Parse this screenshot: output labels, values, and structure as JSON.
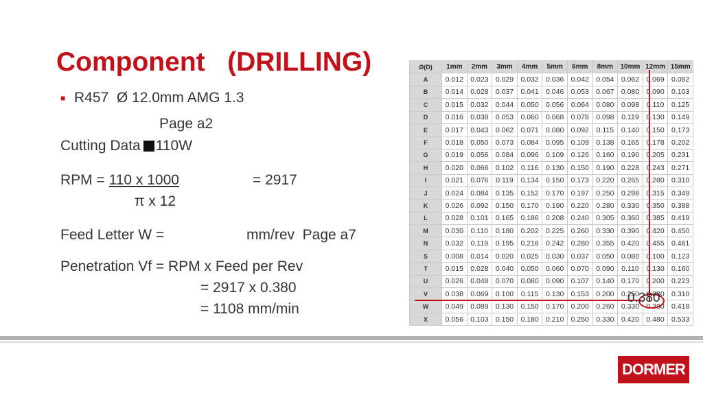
{
  "title": "Component   (DRILLING)",
  "bullet": "R457  Ø 12.0mm AMG 1.3",
  "page_a2": "Page a2",
  "cutting_data_label": "Cutting Data",
  "cutting_data_value": "110W",
  "rpm_prefix": "RPM = ",
  "rpm_numerator": "110 x 1000",
  "rpm_result": "= 2917",
  "rpm_denominator": "π x 12",
  "feed_letter": "Feed Letter W =",
  "feed_unit": "mm/rev  Page a7",
  "penetration": "Penetration Vf = RPM x Feed per Rev",
  "calc1": "= 2917 x 0.380",
  "calc2": "= 1108 mm/min",
  "annotation": "0.380",
  "logo": "DORMER",
  "table": {
    "corner": "Ø(D)",
    "columns": [
      "1mm",
      "2mm",
      "3mm",
      "4mm",
      "5mm",
      "6mm",
      "8mm",
      "10mm",
      "12mm",
      "15mm"
    ],
    "rows": [
      {
        "letter": "A",
        "values": [
          "0.012",
          "0.023",
          "0.029",
          "0.032",
          "0.036",
          "0.042",
          "0.054",
          "0.062",
          "0.069",
          "0.082"
        ]
      },
      {
        "letter": "B",
        "values": [
          "0.014",
          "0.028",
          "0.037",
          "0.041",
          "0.046",
          "0.053",
          "0.067",
          "0.080",
          "0.090",
          "0.103"
        ]
      },
      {
        "letter": "C",
        "values": [
          "0.015",
          "0.032",
          "0.044",
          "0.050",
          "0.056",
          "0.064",
          "0.080",
          "0.098",
          "0.110",
          "0.125"
        ]
      },
      {
        "letter": "D",
        "values": [
          "0.016",
          "0.038",
          "0.053",
          "0.060",
          "0.068",
          "0.078",
          "0.098",
          "0.119",
          "0.130",
          "0.149"
        ]
      },
      {
        "letter": "E",
        "values": [
          "0.017",
          "0.043",
          "0.062",
          "0.071",
          "0.080",
          "0.092",
          "0.115",
          "0.140",
          "0.150",
          "0.173"
        ]
      },
      {
        "letter": "F",
        "values": [
          "0.018",
          "0.050",
          "0.073",
          "0.084",
          "0.095",
          "0.109",
          "0.138",
          "0.165",
          "0.178",
          "0.202"
        ]
      },
      {
        "letter": "G",
        "values": [
          "0.019",
          "0.056",
          "0.084",
          "0.096",
          "0.109",
          "0.126",
          "0.160",
          "0.190",
          "0.205",
          "0.231"
        ]
      },
      {
        "letter": "H",
        "values": [
          "0.020",
          "0.066",
          "0.102",
          "0.116",
          "0.130",
          "0.150",
          "0.190",
          "0.228",
          "0.243",
          "0.271"
        ]
      },
      {
        "letter": "I",
        "values": [
          "0.021",
          "0.076",
          "0.119",
          "0.134",
          "0.150",
          "0.173",
          "0.220",
          "0.265",
          "0.280",
          "0.310"
        ]
      },
      {
        "letter": "J",
        "values": [
          "0.024",
          "0.084",
          "0.135",
          "0.152",
          "0.170",
          "0.197",
          "0.250",
          "0.298",
          "0.315",
          "0.349"
        ]
      },
      {
        "letter": "K",
        "values": [
          "0.026",
          "0.092",
          "0.150",
          "0.170",
          "0.190",
          "0.220",
          "0.280",
          "0.330",
          "0.350",
          "0.388"
        ]
      },
      {
        "letter": "L",
        "values": [
          "0.028",
          "0.101",
          "0.165",
          "0.186",
          "0.208",
          "0.240",
          "0.305",
          "0.360",
          "0.385",
          "0.419"
        ]
      },
      {
        "letter": "M",
        "values": [
          "0.030",
          "0.110",
          "0.180",
          "0.202",
          "0.225",
          "0.260",
          "0.330",
          "0.390",
          "0.420",
          "0.450"
        ]
      },
      {
        "letter": "N",
        "values": [
          "0.032",
          "0.119",
          "0.195",
          "0.218",
          "0.242",
          "0.280",
          "0.355",
          "0.420",
          "0.455",
          "0.481"
        ]
      },
      {
        "letter": "S",
        "values": [
          "0.008",
          "0.014",
          "0.020",
          "0.025",
          "0.030",
          "0.037",
          "0.050",
          "0.080",
          "0.100",
          "0.123"
        ]
      },
      {
        "letter": "T",
        "values": [
          "0.015",
          "0.028",
          "0.040",
          "0.050",
          "0.060",
          "0.070",
          "0.090",
          "0.110",
          "0.130",
          "0.160"
        ]
      },
      {
        "letter": "U",
        "values": [
          "0.026",
          "0.048",
          "0.070",
          "0.080",
          "0.090",
          "0.107",
          "0.140",
          "0.170",
          "0.200",
          "0.223"
        ]
      },
      {
        "letter": "V",
        "values": [
          "0.038",
          "0.069",
          "0.100",
          "0.115",
          "0.130",
          "0.153",
          "0.200",
          "0.250",
          "0.280",
          "0.310"
        ]
      },
      {
        "letter": "W",
        "values": [
          "0.049",
          "0.089",
          "0.130",
          "0.150",
          "0.170",
          "0.200",
          "0.260",
          "0.330",
          "0.380",
          "0.418"
        ]
      },
      {
        "letter": "X",
        "values": [
          "0.056",
          "0.103",
          "0.150",
          "0.180",
          "0.210",
          "0.250",
          "0.330",
          "0.420",
          "0.480",
          "0.533"
        ]
      }
    ]
  }
}
